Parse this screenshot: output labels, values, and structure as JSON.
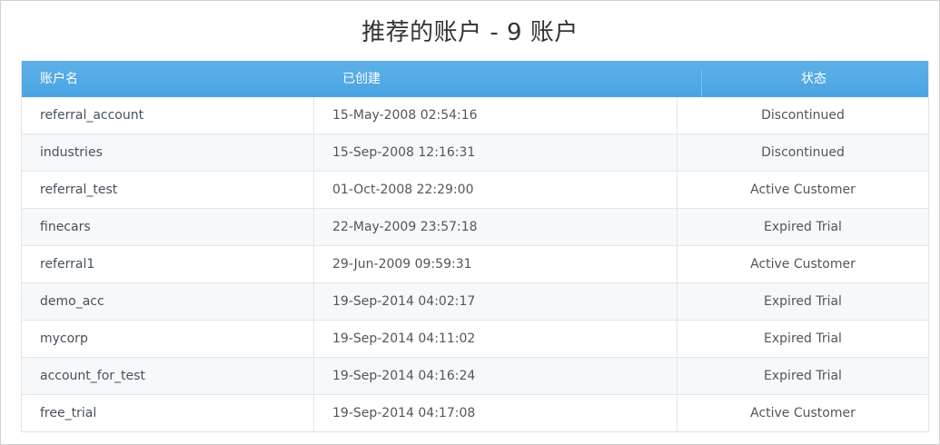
{
  "page": {
    "title": "推荐的账户 - 9 账户"
  },
  "table": {
    "headers": {
      "name": "账户名",
      "created": "已创建",
      "status": "状态"
    },
    "header_color": "#4aa3e2",
    "rows": [
      {
        "name": "referral_account",
        "created": "15-May-2008 02:54:16",
        "status": "Discontinued"
      },
      {
        "name": "industries",
        "created": "15-Sep-2008 12:16:31",
        "status": "Discontinued"
      },
      {
        "name": "referral_test",
        "created": "01-Oct-2008 22:29:00",
        "status": "Active Customer"
      },
      {
        "name": "finecars",
        "created": "22-May-2009 23:57:18",
        "status": "Expired Trial"
      },
      {
        "name": "referral1",
        "created": "29-Jun-2009 09:59:31",
        "status": "Active Customer"
      },
      {
        "name": "demo_acc",
        "created": "19-Sep-2014 04:02:17",
        "status": "Expired Trial"
      },
      {
        "name": "mycorp",
        "created": "19-Sep-2014 04:11:02",
        "status": "Expired Trial"
      },
      {
        "name": "account_for_test",
        "created": "19-Sep-2014 04:16:24",
        "status": "Expired Trial"
      },
      {
        "name": "free_trial",
        "created": "19-Sep-2014 04:17:08",
        "status": "Active Customer"
      }
    ]
  }
}
